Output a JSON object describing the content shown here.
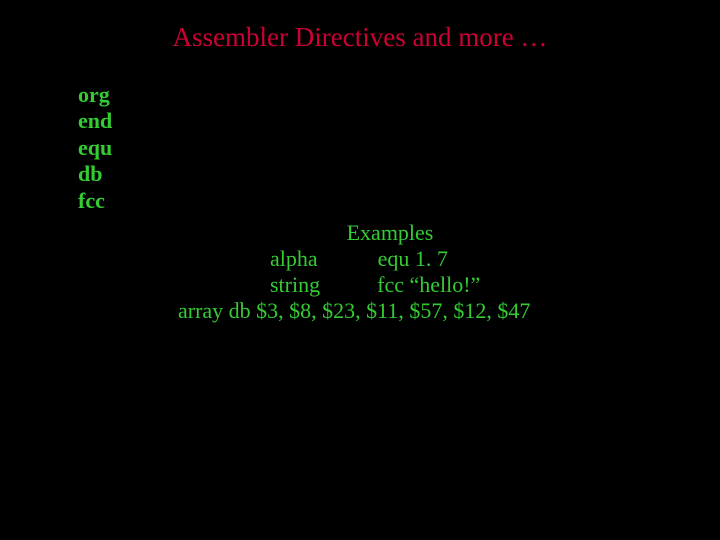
{
  "title": "Assembler Directives and more …",
  "directives": {
    "item1": "org",
    "item2": "end",
    "item3": "equ",
    "item4": "db",
    "item5": "fcc"
  },
  "examples": {
    "heading": "Examples",
    "line1_label": "alpha",
    "line1_value": "equ 1. 7",
    "line2_label": "string",
    "line2_value": "fcc “hello!”",
    "line3": "array db $3, $8, $23, $11, $57, $12, $47"
  }
}
